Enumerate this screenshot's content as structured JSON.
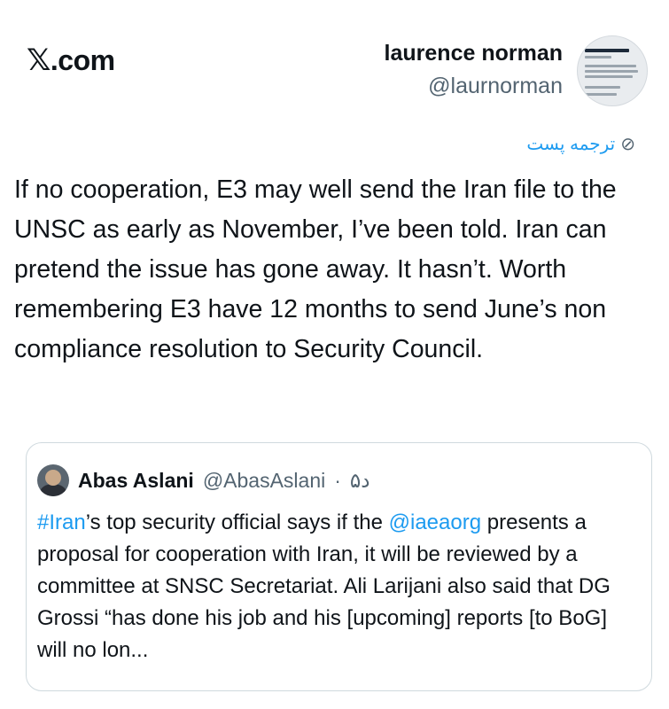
{
  "site": {
    "logo_x": "𝕏",
    "logo_text": ".com"
  },
  "author": {
    "name": "laurence norman",
    "handle": "@laurnorman"
  },
  "translate": {
    "label": "ترجمه پست",
    "icon": "globe-translate-icon"
  },
  "tweet": {
    "text": "If no cooperation, E3 may well send the Iran file to the UNSC as early as November, I’ve been told. Iran can pretend the issue has gone away. It hasn’t. Worth remembering E3 have 12 months to send June’s non compliance resolution to Security Council."
  },
  "quote": {
    "name": "Abas Aslani",
    "handle": "@AbasAslani",
    "separator": "·",
    "time": "۵د",
    "body_hashtag": "#Iran",
    "body_part1": "’s top security official says if the ",
    "body_mention": "@iaeaorg",
    "body_part2": " presents a proposal for cooperation with Iran, it will be reviewed by a committee at SNSC Secretariat. Ali Larijani also said that DG Grossi “has done his job and his [upcoming] reports [to BoG] will no lon..."
  },
  "colors": {
    "link": "#1d9bf0",
    "muted": "#536471",
    "text": "#0f1419",
    "border": "#cfd9de"
  }
}
